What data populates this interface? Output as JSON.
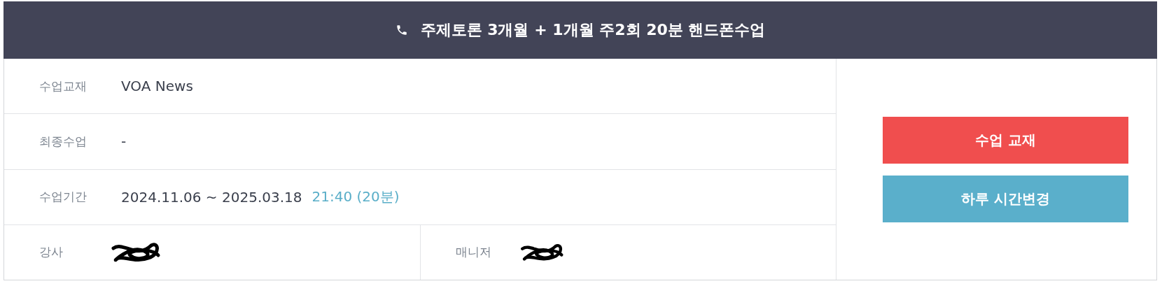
{
  "header": {
    "title": "주제토론 3개월 + 1개월 주2회 20분 핸드폰수업"
  },
  "rows": [
    {
      "label": "수업교재",
      "value": "VOA News"
    },
    {
      "label": "최종수업",
      "value": "-"
    },
    {
      "label": "수업기간",
      "value": "2024.11.06 ~ 2025.03.18",
      "time": "21:40 (20분)"
    }
  ],
  "people": [
    {
      "label": "강사"
    },
    {
      "label": "매니저"
    }
  ],
  "buttons": [
    {
      "label": "수업 교재",
      "kind": "primary"
    },
    {
      "label": "하루 시간변경",
      "kind": "secondary"
    }
  ]
}
